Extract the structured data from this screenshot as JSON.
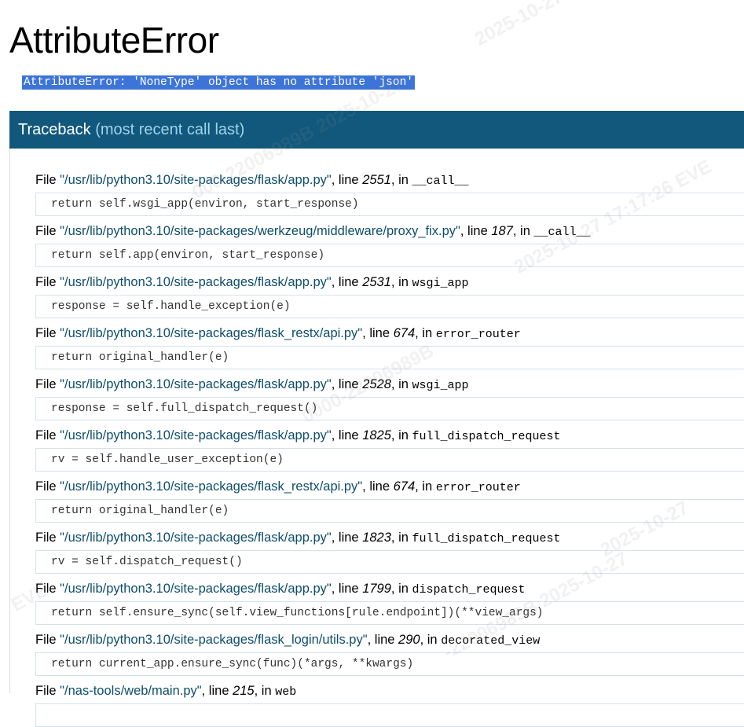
{
  "page": {
    "title": "AttributeError",
    "error_message": "AttributeError: 'NoneType' object has no attribute 'json'"
  },
  "traceback": {
    "header": "Traceback",
    "header_sub": "(most recent call last)",
    "frames": [
      {
        "file": "\"/usr/lib/python3.10/site-packages/flask/app.py\"",
        "line": "2551",
        "func": "__call__",
        "code": "return self.wsgi_app(environ, start_response)"
      },
      {
        "file": "\"/usr/lib/python3.10/site-packages/werkzeug/middleware/proxy_fix.py\"",
        "line": "187",
        "func": "__call__",
        "code": "return self.app(environ, start_response)"
      },
      {
        "file": "\"/usr/lib/python3.10/site-packages/flask/app.py\"",
        "line": "2531",
        "func": "wsgi_app",
        "code": "response = self.handle_exception(e)"
      },
      {
        "file": "\"/usr/lib/python3.10/site-packages/flask_restx/api.py\"",
        "line": "674",
        "func": "error_router",
        "code": "return original_handler(e)"
      },
      {
        "file": "\"/usr/lib/python3.10/site-packages/flask/app.py\"",
        "line": "2528",
        "func": "wsgi_app",
        "code": "response = self.full_dispatch_request()"
      },
      {
        "file": "\"/usr/lib/python3.10/site-packages/flask/app.py\"",
        "line": "1825",
        "func": "full_dispatch_request",
        "code": "rv = self.handle_user_exception(e)"
      },
      {
        "file": "\"/usr/lib/python3.10/site-packages/flask_restx/api.py\"",
        "line": "674",
        "func": "error_router",
        "code": "return original_handler(e)"
      },
      {
        "file": "\"/usr/lib/python3.10/site-packages/flask/app.py\"",
        "line": "1823",
        "func": "full_dispatch_request",
        "code": "rv = self.dispatch_request()"
      },
      {
        "file": "\"/usr/lib/python3.10/site-packages/flask/app.py\"",
        "line": "1799",
        "func": "dispatch_request",
        "code": "return self.ensure_sync(self.view_functions[rule.endpoint])(**view_args)"
      },
      {
        "file": "\"/usr/lib/python3.10/site-packages/flask_login/utils.py\"",
        "line": "290",
        "func": "decorated_view",
        "code": "return current_app.ensure_sync(func)(*args, **kwargs)"
      },
      {
        "file": "\"/nas-tools/web/main.py\"",
        "line": "215",
        "func": "web",
        "code": ""
      }
    ]
  },
  "labels": {
    "file_prefix": "File ",
    "line_prefix": ", line ",
    "in_prefix": ", in "
  },
  "watermarks": [
    "2025-10-27 17:",
    "000-22006989B 2025-10-27",
    "2025-10-27 17:17:26 EVE",
    "0000-22006989B",
    "EVE",
    "2025-10-27",
    "-22006989B 2025-10-27"
  ]
}
